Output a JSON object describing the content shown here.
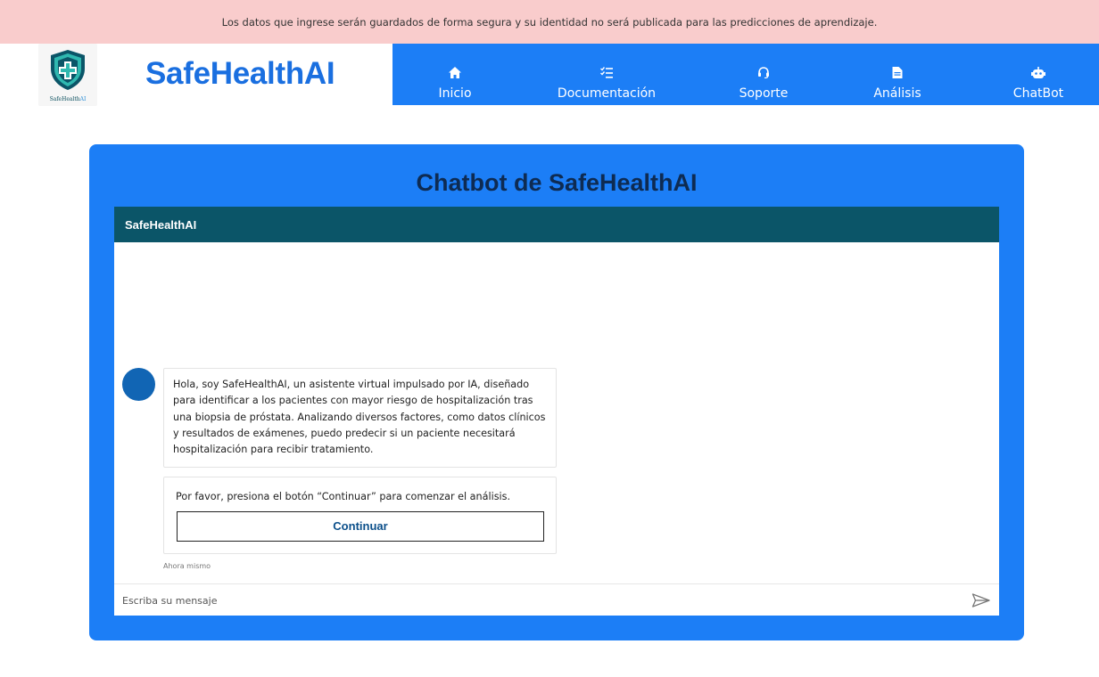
{
  "notice": {
    "text": "Los datos que ingrese serán guardados de forma segura y su identidad no será publicada para las predicciones de aprendizaje."
  },
  "header": {
    "logo_text": "SafeHealth",
    "logo_text_ai": "AI",
    "brand": "SafeHealthAI"
  },
  "nav": {
    "items": [
      {
        "label": "Inicio",
        "icon": "home-icon"
      },
      {
        "label": "Documentación",
        "icon": "list-check-icon"
      },
      {
        "label": "Soporte",
        "icon": "headset-icon"
      },
      {
        "label": "Análisis",
        "icon": "document-icon"
      },
      {
        "label": "ChatBot",
        "icon": "robot-icon"
      }
    ]
  },
  "panel": {
    "title": "Chatbot de SafeHealthAI"
  },
  "chat": {
    "header_title": "SafeHealthAI",
    "messages": [
      {
        "text": "Hola, soy SafeHealthAI, un asistente virtual impulsado por IA, diseñado para identificar a los pacientes con mayor riesgo de hospitalización tras una biopsia de próstata. Analizando diversos factores, como datos clínicos y resultados de exámenes, puedo predecir si un paciente necesitará hospitalización para recibir tratamiento."
      },
      {
        "text": "Por favor, presiona el botón “Continuar” para comenzar el análisis."
      }
    ],
    "continue_label": "Continuar",
    "timestamp": "Ahora mismo",
    "input_placeholder": "Escriba su mensaje",
    "input_value": ""
  },
  "colors": {
    "notice_bg": "#f9cccc",
    "brand": "#1a6fe0",
    "nav_bg": "#1c7ef6",
    "chat_header_bg": "#0b5568",
    "avatar": "#1165b4",
    "title": "#0e2b52"
  }
}
